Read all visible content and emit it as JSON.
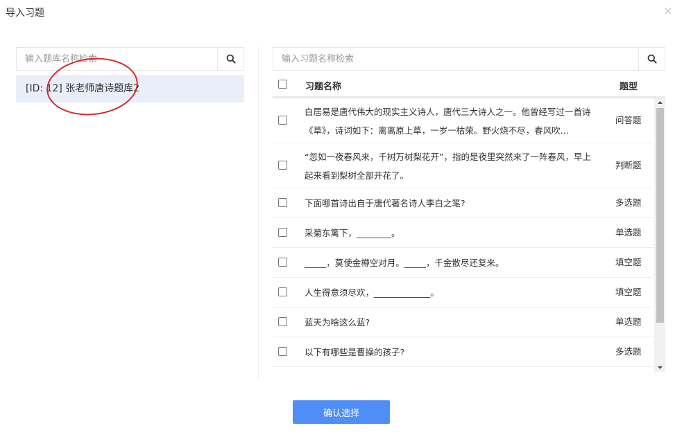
{
  "dialog": {
    "title": "导入习题",
    "close_symbol": "×"
  },
  "left": {
    "search": {
      "placeholder": "输入题库名称检索",
      "icon": "search-icon"
    },
    "banks": [
      {
        "label": "[ID: 12] 张老师唐诗题库2",
        "selected": true
      }
    ]
  },
  "right": {
    "search": {
      "placeholder": "输入习题名称检索",
      "icon": "search-icon"
    },
    "columns": {
      "name": "习题名称",
      "type": "题型"
    },
    "rows": [
      {
        "text": "白居易是唐代伟大的现实主义诗人，唐代三大诗人之一。他曾经写过一首诗《草》，诗词如下：离离原上草，一岁一枯荣。野火烧不尽，春风吹...",
        "type": "问答题"
      },
      {
        "text": "“忽如一夜春风来，千树万树梨花开”，指的是夜里突然来了一阵春风，早上起来看到梨树全部开花了。",
        "type": "判断题"
      },
      {
        "text": "下面哪首诗出自于唐代著名诗人李白之笔?",
        "type": "多选题"
      },
      {
        "text": "采菊东篱下，________。",
        "type": "单选题"
      },
      {
        "text": "_____，莫使金樽空对月。_____，千金散尽还复来。",
        "type": "填空题"
      },
      {
        "text": "人生得意须尽欢，_____________。",
        "type": "填空题"
      },
      {
        "text": "蓝天为啥这么蓝?",
        "type": "单选题"
      },
      {
        "text": "以下有哪些是曹操的孩子?",
        "type": "多选题"
      }
    ]
  },
  "footer": {
    "confirm_label": "确认选择"
  },
  "colors": {
    "accent": "#4f8ef7",
    "selected_bg": "#e9eef9",
    "annotation": "#d9262d"
  }
}
